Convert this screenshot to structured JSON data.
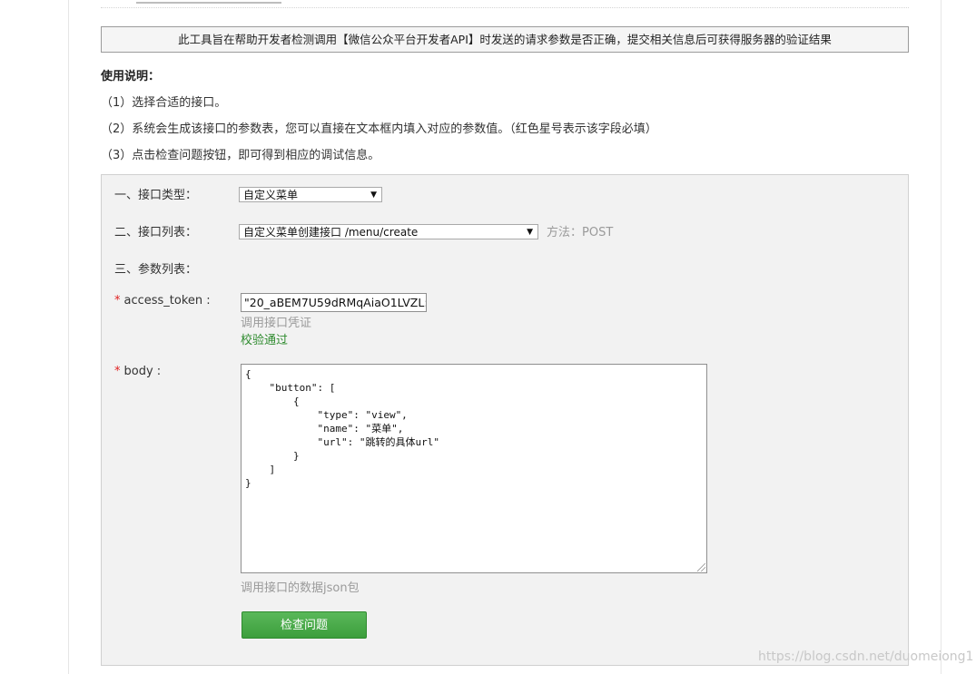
{
  "notice": "此工具旨在帮助开发者检测调用【微信公众平台开发者API】时发送的请求参数是否正确，提交相关信息后可获得服务器的验证结果",
  "usage": {
    "title": "使用说明：",
    "steps": [
      "（1）选择合适的接口。",
      "（2）系统会生成该接口的参数表，您可以直接在文本框内填入对应的参数值。（红色星号表示该字段必填）",
      "（3）点击检查问题按钮，即可得到相应的调试信息。"
    ]
  },
  "form": {
    "type_label": "一、接口类型：",
    "type_value": "自定义菜单",
    "list_label": "二、接口列表：",
    "list_value": "自定义菜单创建接口 /menu/create",
    "method": "方法：POST",
    "params_label": "三、参数列表：",
    "required_mark": "*",
    "token_label": "access_token :",
    "token_value": "\"20_aBEM7U59dRMqAiaO1LVZL:",
    "token_hint": "调用接口凭证",
    "token_status": "校验通过",
    "body_label": "body :",
    "body_value": "{\n    \"button\": [\n        {\n            \"type\": \"view\",\n            \"name\": \"菜单\",\n            \"url\": \"跳转的具体url\"\n        }\n    ]\n}",
    "body_hint": "调用接口的数据json包",
    "submit_label": "检查问题"
  },
  "watermark": "https://blog.csdn.net/duomeiong1",
  "colors": {
    "button": "#4aa84a",
    "required": "#e02020",
    "success": "#2e8b2e",
    "hint": "#9a9a9a"
  }
}
